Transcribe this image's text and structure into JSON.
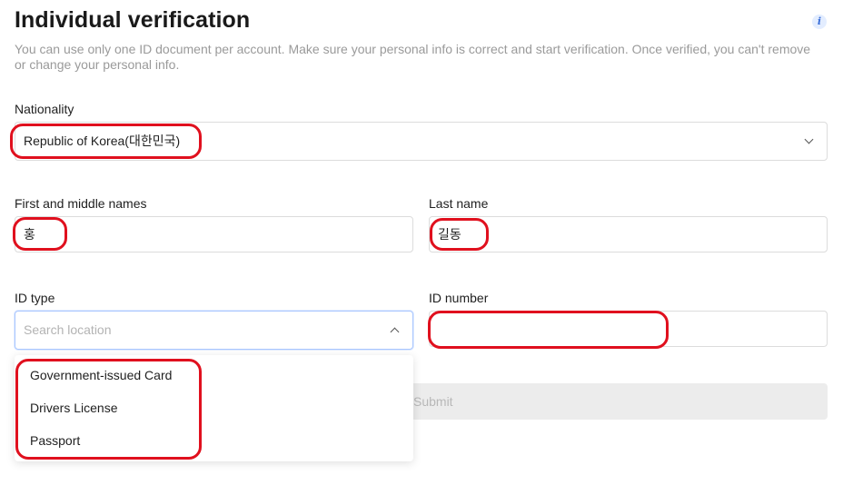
{
  "page": {
    "title": "Individual verification",
    "subtitle": "You can use only one ID document per account. Make sure your personal info is correct and start verification. Once verified, you can't remove or change your personal info."
  },
  "form": {
    "nationality": {
      "label": "Nationality",
      "value": "Republic of Korea(대한민국)"
    },
    "first_name": {
      "label": "First and middle names",
      "value": "홍"
    },
    "last_name": {
      "label": "Last name",
      "value": "길동"
    },
    "id_type": {
      "label": "ID type",
      "placeholder": "Search location",
      "options": [
        "Government-issued Card",
        "Drivers License",
        "Passport"
      ]
    },
    "id_number": {
      "label": "ID number",
      "value": ""
    },
    "submit_label": "Submit"
  },
  "icons": {
    "info": "info-icon",
    "nationality_chevron": "chevron-down-icon",
    "id_type_chevron": "chevron-up-icon"
  },
  "colors": {
    "highlight": "#e0101e",
    "focus_border": "#a9c7ff",
    "info_icon": "#3b6fd8"
  }
}
